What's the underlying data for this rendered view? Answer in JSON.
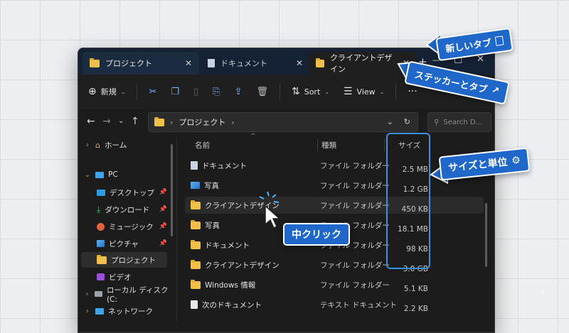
{
  "tabs": [
    {
      "label": "プロジェクト",
      "icon": "folder-icon"
    },
    {
      "label": "ドキュメント",
      "icon": "document-icon"
    },
    {
      "label": "クライアントデザイン",
      "icon": "folder-icon"
    }
  ],
  "window_controls": {
    "new_tab": "+",
    "minimize": "—",
    "maximize": "□",
    "close": "✕"
  },
  "toolbar": {
    "new_label": "新規",
    "sort_label": "Sort",
    "view_label": "View",
    "more_label": "···"
  },
  "address": {
    "crumb": "プロジェクト",
    "search_placeholder": "Search D..."
  },
  "sidebar": {
    "items": [
      {
        "label": "ホーム"
      },
      {
        "label": "PC"
      },
      {
        "label": "デスクトップ"
      },
      {
        "label": "ダウンロード"
      },
      {
        "label": "ミュージック"
      },
      {
        "label": "ピクチャ"
      },
      {
        "label": "プロジェクト"
      },
      {
        "label": "ビデオ"
      },
      {
        "label": "ローカル ディスク (C:"
      },
      {
        "label": "ネットワーク"
      }
    ]
  },
  "columns": {
    "name": "名前",
    "type": "種類",
    "size": "サイズ"
  },
  "files": [
    {
      "name": "ドキュメント",
      "type": "ファイル フォルダー",
      "size": "2.5 MB",
      "icon": "document-icon"
    },
    {
      "name": "写真",
      "type": "ファイル フォルダー",
      "size": "1.2 GB",
      "icon": "photo-icon"
    },
    {
      "name": "クライアントデザイン",
      "type": "ファイル フォルダー",
      "size": "450 KB",
      "icon": "folder-icon"
    },
    {
      "name": "写真",
      "type": "ファイル フォルダー",
      "size": "18.1 MB",
      "icon": "folder-icon"
    },
    {
      "name": "ドキュメント",
      "type": "ファイル フォルダー",
      "size": "98 KB",
      "icon": "folder-icon"
    },
    {
      "name": "クライアントデザイン",
      "type": "ファイル フォルダー",
      "size": "3.0 GB",
      "icon": "folder-icon"
    },
    {
      "name": "Windows 情報",
      "type": "ファイル フォルダー",
      "size": "5.1 KB",
      "icon": "folder-icon"
    },
    {
      "name": "次のドキュメント",
      "type": "テキスト ドキュメント",
      "size": "2.2 KB",
      "icon": "text-file-icon"
    }
  ],
  "callouts": {
    "new_tab": "新しいタブ",
    "sticker_tab": "ステッカーとタブ",
    "size_unit": "サイズと単位",
    "middle_click": "中クリック"
  },
  "colors": {
    "accent": "#1f67c8",
    "folder": "#f0c04a",
    "highlight": "#3d8fe0"
  }
}
